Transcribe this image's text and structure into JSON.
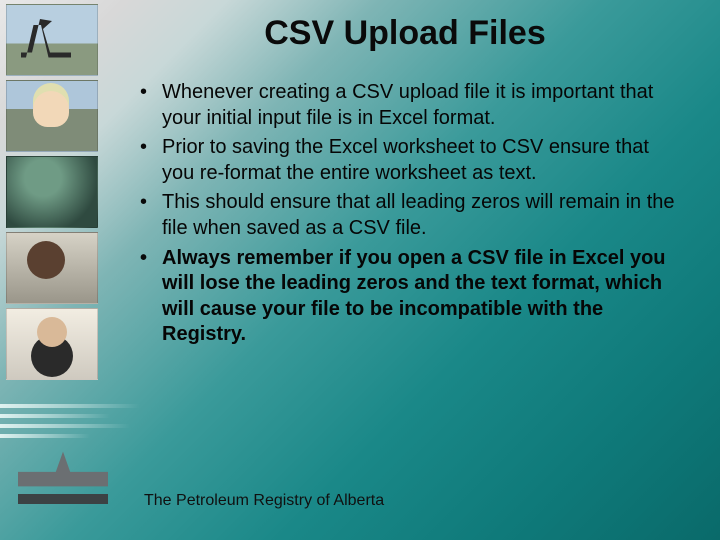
{
  "title": "CSV Upload Files",
  "bullets": [
    {
      "text": "Whenever creating a CSV upload file it is important that your initial input file is in Excel format.",
      "bold": false
    },
    {
      "text": "Prior to saving the Excel worksheet to CSV ensure that you re-format the entire worksheet as text.",
      "bold": false
    },
    {
      "text": "This should ensure that all leading zeros will remain in the file when saved as a CSV file.",
      "bold": false
    },
    {
      "text": "Always remember if you open a CSV file in Excel you will lose the leading zeros and the text format, which will cause your file to be incompatible with the Registry.",
      "bold": true
    }
  ],
  "footer": "The Petroleum Registry of Alberta",
  "sidebar_images": [
    "oil-pumpjack",
    "worker-hardhat",
    "storm-field",
    "person-on-phone",
    "executive-laptop"
  ]
}
